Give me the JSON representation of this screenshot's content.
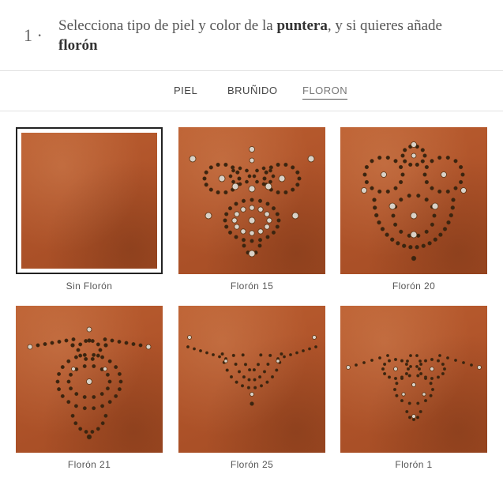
{
  "header": {
    "step_number": "1 ·",
    "title_part1": "Selecciona tipo de piel y color de la ",
    "title_bold1": "puntera",
    "title_part2": ", y si quieres añade ",
    "title_bold2": "florón"
  },
  "tabs": [
    {
      "label": "PIEL",
      "active": false
    },
    {
      "label": "BRUÑIDO",
      "active": false
    },
    {
      "label": "FLORON",
      "active": true
    }
  ],
  "options": [
    {
      "label": "Sin Florón",
      "selected": true
    },
    {
      "label": "Florón 15",
      "selected": false
    },
    {
      "label": "Florón 20",
      "selected": false
    },
    {
      "label": "Florón 21",
      "selected": false
    },
    {
      "label": "Florón 25",
      "selected": false
    },
    {
      "label": "Florón 1",
      "selected": false
    }
  ],
  "colors": {
    "leather": "#b0542a",
    "selected_border": "#222222",
    "hole_dark": "#3a2410",
    "hole_light": "#d9d2c8"
  }
}
